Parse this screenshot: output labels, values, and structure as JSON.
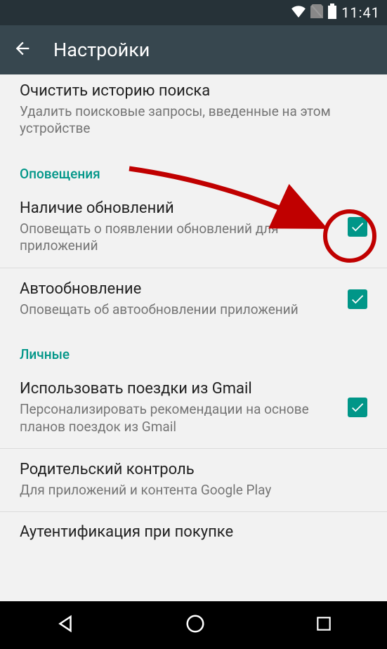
{
  "status": {
    "time": "11:41"
  },
  "appbar": {
    "title": "Настройки"
  },
  "items": {
    "clear_history": {
      "title": "Очистить историю поиска",
      "subtitle": "Удалить поисковые запросы, введенные на этом устройстве"
    },
    "notifications_header": "Оповещения",
    "updates_available": {
      "title": "Наличие обновлений",
      "subtitle": "Оповещать о появлении обновлений для приложений",
      "checked": true
    },
    "auto_update": {
      "title": "Автообновление",
      "subtitle": "Оповещать об автообновлении приложений",
      "checked": true
    },
    "personal_header": "Личные",
    "gmail_trips": {
      "title": "Использовать поездки из Gmail",
      "subtitle": "Персонализировать рекомендации на основе планов поездок из Gmail",
      "checked": true
    },
    "parental": {
      "title": "Родительский контроль",
      "subtitle": "Для приложений и контента Google Play"
    },
    "auth_purchase": {
      "title": "Аутентификация при покупке"
    }
  }
}
